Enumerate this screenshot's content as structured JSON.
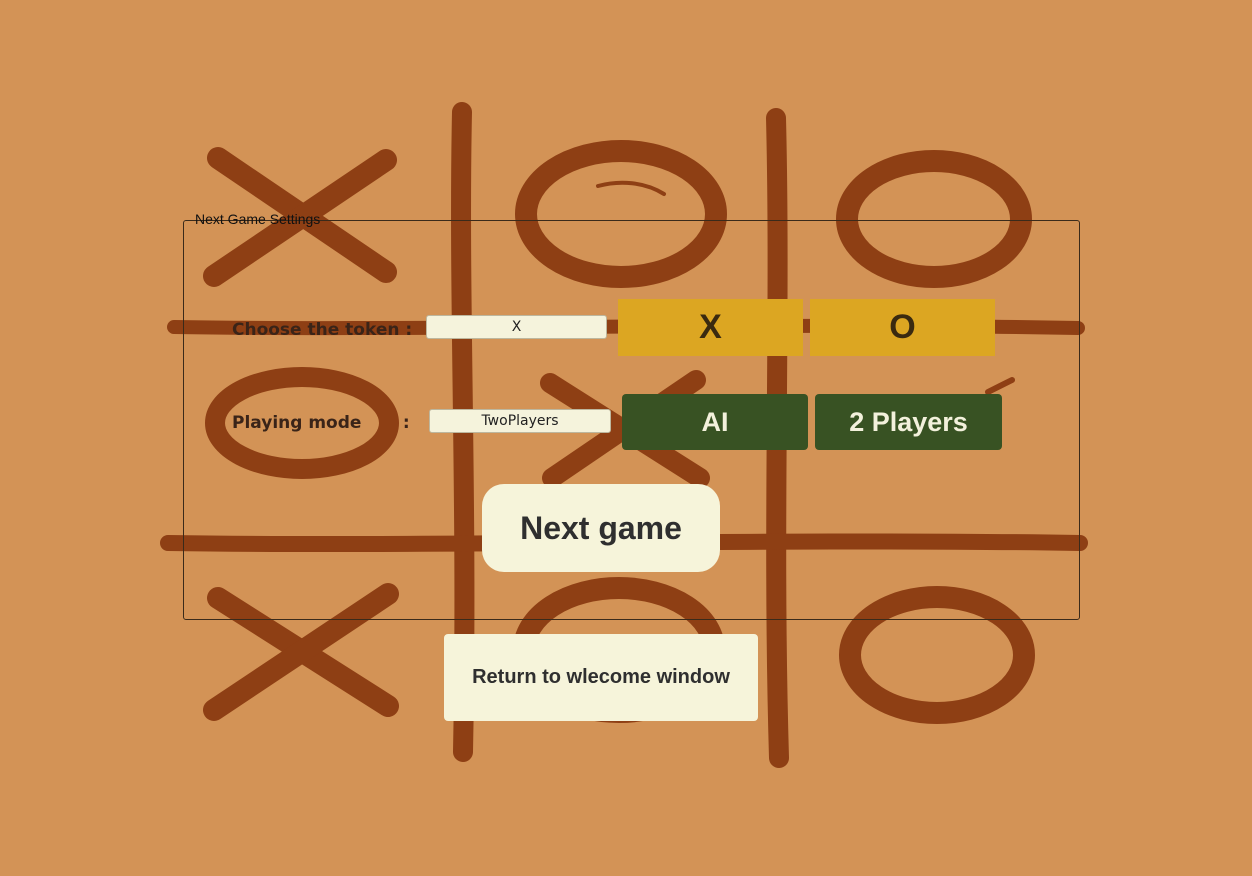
{
  "settings": {
    "legend": "Next Game Settings",
    "token_label": "Choose the token :",
    "token_value": "X",
    "token_options": [
      "X",
      "O"
    ],
    "mode_label": "Playing mode       :",
    "mode_value": "TwoPlayers",
    "mode_options": [
      "AI",
      "2 Players"
    ],
    "next_button": "Next game"
  },
  "return_button": "Return to wlecome window",
  "colors": {
    "background": "#d39356",
    "brush": "#8e3f14",
    "token_button": "#dca622",
    "mode_button": "#385223",
    "light_button": "#f6f4da"
  },
  "board_background": {
    "cells": [
      "X",
      "O",
      "O",
      "O",
      "X",
      "",
      "X",
      "O",
      "O"
    ]
  }
}
